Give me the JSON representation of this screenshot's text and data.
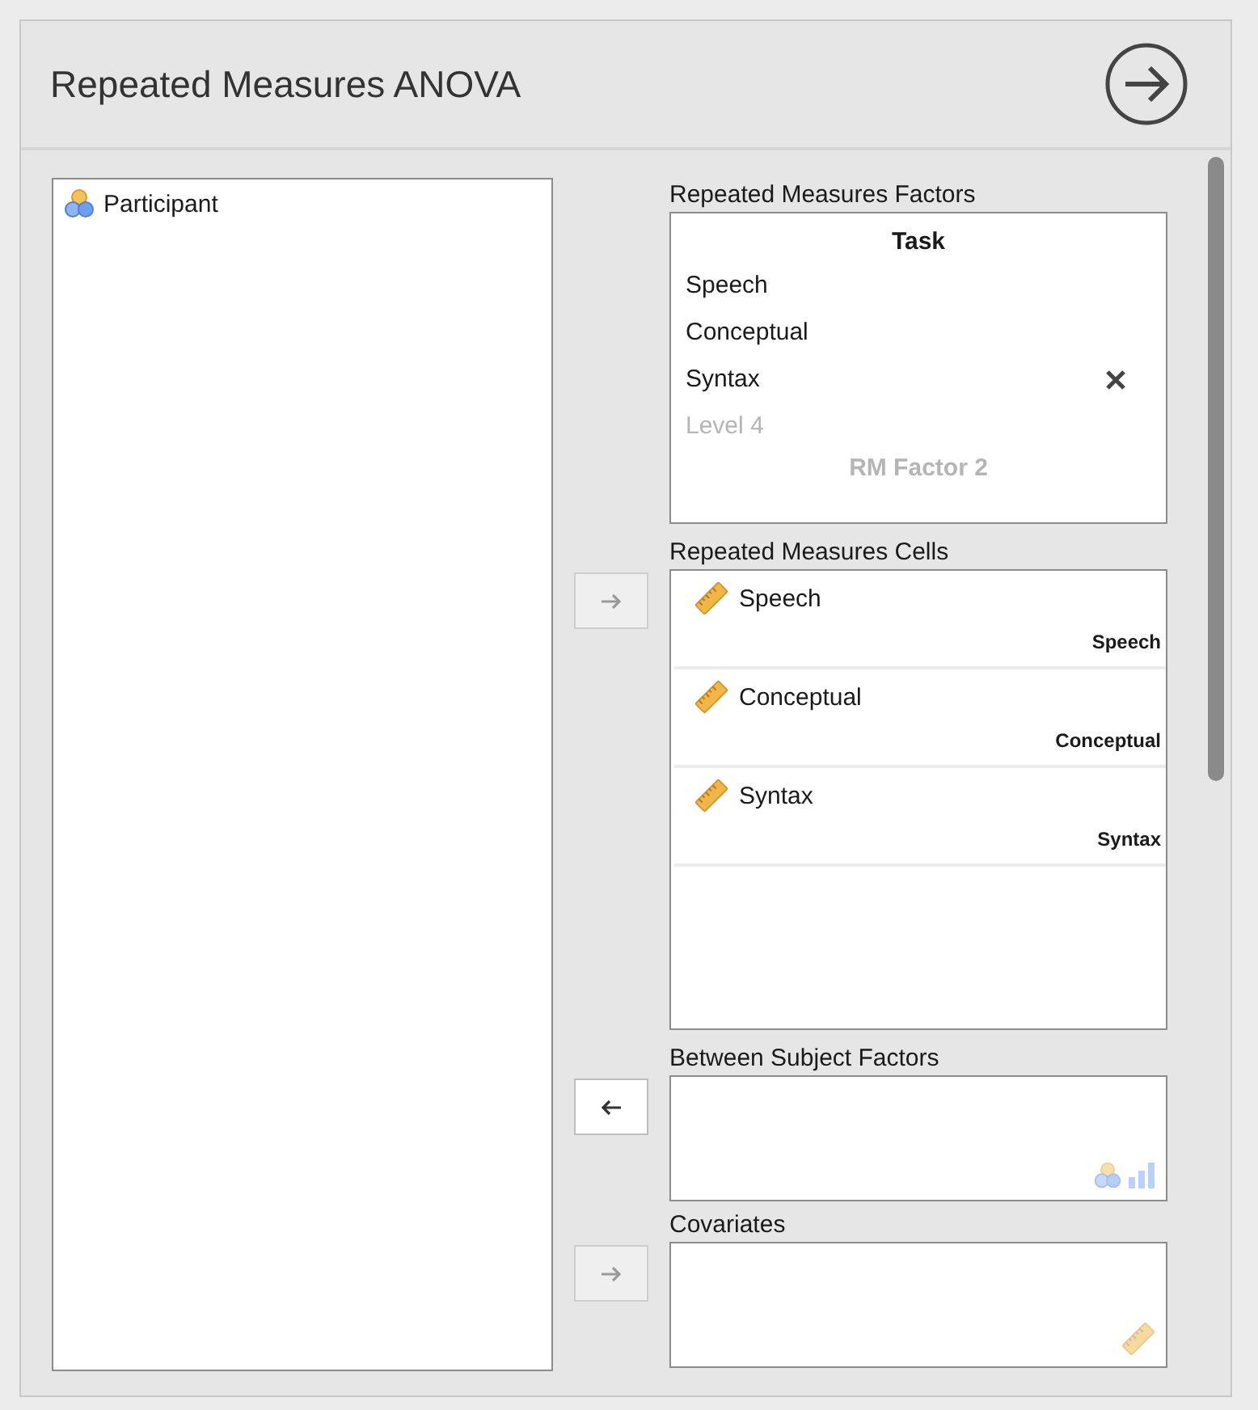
{
  "title": "Repeated Measures ANOVA",
  "variables": [
    {
      "name": "Participant",
      "kind": "nominal"
    }
  ],
  "factors": {
    "label": "Repeated Measures Factors",
    "groups": [
      {
        "name": "Task",
        "placeholder": false,
        "levels": [
          {
            "label": "Speech",
            "placeholder": false,
            "removable": false
          },
          {
            "label": "Conceptual",
            "placeholder": false,
            "removable": false
          },
          {
            "label": "Syntax",
            "placeholder": false,
            "removable": true
          },
          {
            "label": "Level 4",
            "placeholder": true,
            "removable": false
          }
        ]
      },
      {
        "name": "RM Factor 2",
        "placeholder": true
      }
    ]
  },
  "cells": {
    "label": "Repeated Measures Cells",
    "button": {
      "kind": "right",
      "disabled": true
    },
    "items": [
      {
        "variable": "Speech",
        "cell": "Speech"
      },
      {
        "variable": "Conceptual",
        "cell": "Conceptual"
      },
      {
        "variable": "Syntax",
        "cell": "Syntax"
      }
    ]
  },
  "between": {
    "label": "Between Subject Factors",
    "button": {
      "kind": "left",
      "disabled": false
    },
    "accepts": [
      {
        "kind": "nominal"
      },
      {
        "kind": "ordinal"
      }
    ]
  },
  "covariates": {
    "label": "Covariates",
    "button": {
      "kind": "right",
      "disabled": true
    },
    "accepts": [
      {
        "kind": "scale"
      }
    ]
  }
}
